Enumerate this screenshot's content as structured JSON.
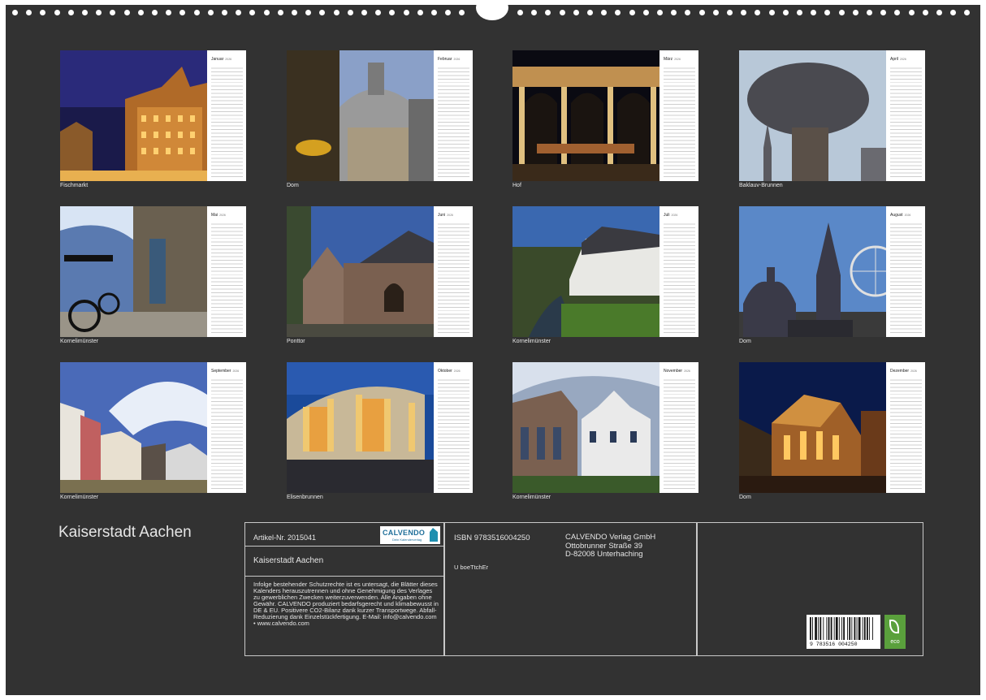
{
  "months": [
    {
      "month": "Januar",
      "year": "2026",
      "caption": "Fischmarkt",
      "scene": "fischmarkt"
    },
    {
      "month": "Februar",
      "year": "2026",
      "caption": "Dom",
      "scene": "dom_feb"
    },
    {
      "month": "März",
      "year": "2026",
      "caption": "Hof",
      "scene": "hof"
    },
    {
      "month": "April",
      "year": "2026",
      "caption": "Baklauv-Brunnen",
      "scene": "bahkauv"
    },
    {
      "month": "Mai",
      "year": "2026",
      "caption": "Kornelimünster",
      "scene": "bank"
    },
    {
      "month": "Juni",
      "year": "2026",
      "caption": "Ponttor",
      "scene": "ponttor"
    },
    {
      "month": "Juli",
      "year": "2026",
      "caption": "Kornelimünster",
      "scene": "inde"
    },
    {
      "month": "August",
      "year": "2026",
      "caption": "Dom",
      "scene": "dom_aug"
    },
    {
      "month": "September",
      "year": "2026",
      "caption": "Kornelimünster",
      "scene": "platz"
    },
    {
      "month": "Oktober",
      "year": "2026",
      "caption": "Elisenbrunnen",
      "scene": "elisen"
    },
    {
      "month": "November",
      "year": "2026",
      "caption": "Kornelimünster",
      "scene": "abtei"
    },
    {
      "month": "Dezember",
      "year": "2026",
      "caption": "Dom",
      "scene": "dom_dez"
    }
  ],
  "back": {
    "title": "Kaiserstadt Aachen",
    "article_no": "Artikel-Nr. 2015041",
    "logo_text": "CALVENDO",
    "logo_sub": "Dein Kalenderverlag",
    "product_title": "Kaiserstadt Aachen",
    "legal_text": "Infolge bestehender Schutzrechte ist es untersagt, die Blätter dieses Kalenders herauszutrennen und ohne Genehmigung des Verlages zu gewerblichen Zwecken weiterzuverwenden. Alle Angaben ohne Gewähr. CALVENDO produziert bedarfsgerecht und klimabewusst in DE & EU. Positivere CO2-Bilanz dank kurzer Transportwege. Abfall-Reduzierung dank Einzelstückfertigung. E-Mail: info@calvendo.com • www.calvendo.com",
    "isbn": "ISBN 9783516004250",
    "publisher_lines": [
      "CALVENDO Verlag GmbH",
      "Ottobrunner Straße 39",
      "D-82008 Unterhaching"
    ],
    "author": "U boeTtchEr",
    "barcode_digits": "9 783516 004250",
    "eco_label": "eco"
  }
}
